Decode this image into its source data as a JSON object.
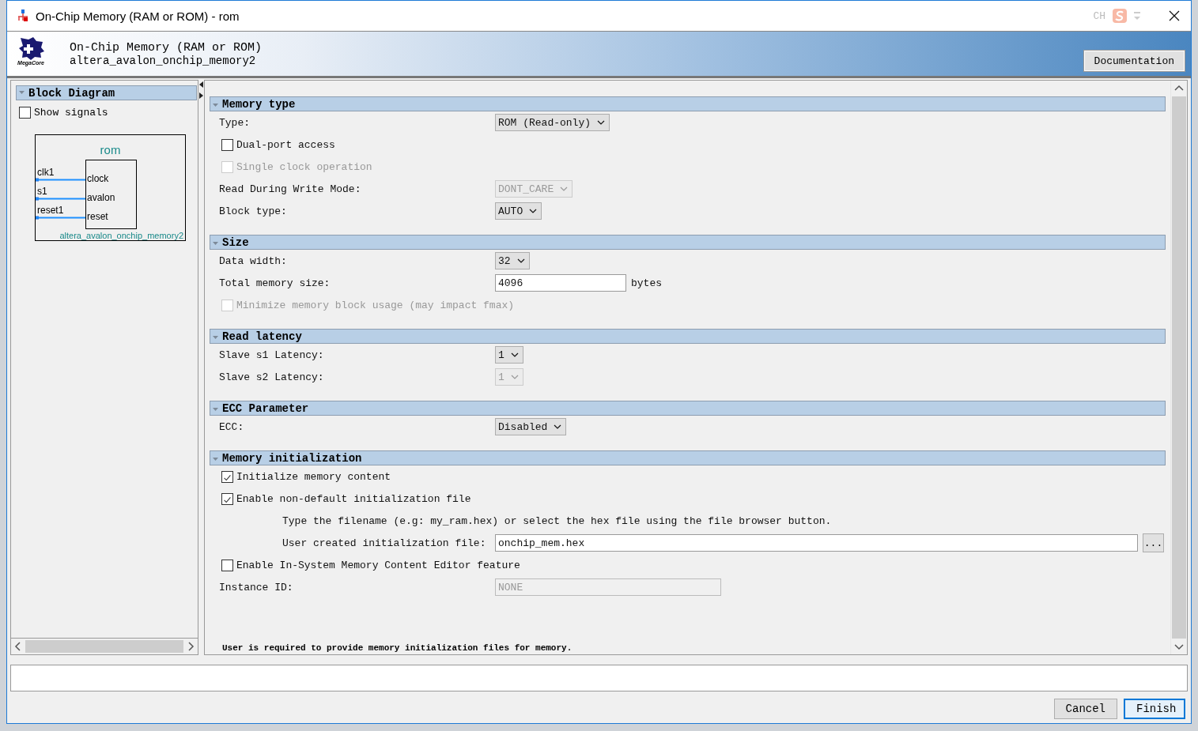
{
  "window": {
    "title": "On-Chip Memory (RAM or ROM) - rom"
  },
  "ime": {
    "text": "CH"
  },
  "header": {
    "title": "On-Chip Memory (RAM or ROM)",
    "subtitle": "altera_avalon_onchip_memory2",
    "logo_text": "MegaCore",
    "documentation_button": "Documentation"
  },
  "left_panel": {
    "title": "Block Diagram",
    "expanded": true,
    "show_signals": {
      "label": "Show signals",
      "checked": false
    },
    "diagram": {
      "instance": "rom",
      "module": "altera_avalon_onchip_memory2",
      "ports": [
        {
          "signal": "clk1",
          "interface": "clock"
        },
        {
          "signal": "s1",
          "interface": "avalon"
        },
        {
          "signal": "reset1",
          "interface": "reset"
        }
      ]
    }
  },
  "sections": [
    {
      "title": "Memory type",
      "expanded": true,
      "items": [
        {
          "kind": "select",
          "label": "Type:",
          "value": "ROM (Read-only)",
          "disabled": false
        },
        {
          "kind": "checkbox",
          "label": "Dual-port access",
          "checked": false,
          "disabled": false
        },
        {
          "kind": "checkbox",
          "label": "Single clock operation",
          "checked": false,
          "disabled": true
        },
        {
          "kind": "select",
          "label": "Read During Write Mode:",
          "value": "DONT_CARE",
          "disabled": true
        },
        {
          "kind": "select",
          "label": "Block type:",
          "value": "AUTO",
          "disabled": false
        }
      ]
    },
    {
      "title": "Size",
      "expanded": true,
      "items": [
        {
          "kind": "select",
          "label": "Data width:",
          "value": "32",
          "disabled": false
        },
        {
          "kind": "text",
          "label": "Total memory size:",
          "value": "4096",
          "unit": "bytes",
          "disabled": false
        },
        {
          "kind": "checkbox",
          "label": "Minimize memory block usage (may impact fmax)",
          "checked": false,
          "disabled": true
        }
      ]
    },
    {
      "title": "Read latency",
      "expanded": true,
      "items": [
        {
          "kind": "select",
          "label": "Slave s1 Latency:",
          "value": "1",
          "disabled": false
        },
        {
          "kind": "select",
          "label": "Slave s2 Latency:",
          "value": "1",
          "disabled": true
        }
      ]
    },
    {
      "title": "ECC Parameter",
      "expanded": true,
      "items": [
        {
          "kind": "select",
          "label": "ECC:",
          "value": "Disabled",
          "disabled": false
        }
      ]
    },
    {
      "title": "Memory initialization",
      "expanded": true,
      "items": [
        {
          "kind": "checkbox",
          "label": "Initialize memory content",
          "checked": true,
          "disabled": false
        },
        {
          "kind": "checkbox",
          "label": "Enable non-default initialization file",
          "checked": true,
          "disabled": false
        },
        {
          "kind": "note",
          "label": "Type the filename (e.g: my_ram.hex) or select the hex file using the file browser button."
        },
        {
          "kind": "file",
          "label": "User created initialization file:",
          "value": "onchip_mem.hex",
          "browse": "...",
          "disabled": false
        },
        {
          "kind": "checkbox",
          "label": "Enable In-System Memory Content Editor feature",
          "checked": false,
          "disabled": false
        },
        {
          "kind": "text",
          "label": "Instance ID:",
          "value": "NONE",
          "disabled": true
        }
      ]
    }
  ],
  "message": "User is required to provide memory initialization files for memory.",
  "buttons": [
    {
      "label": "Cancel",
      "default": false
    },
    {
      "label": "Finish",
      "default": true
    }
  ]
}
